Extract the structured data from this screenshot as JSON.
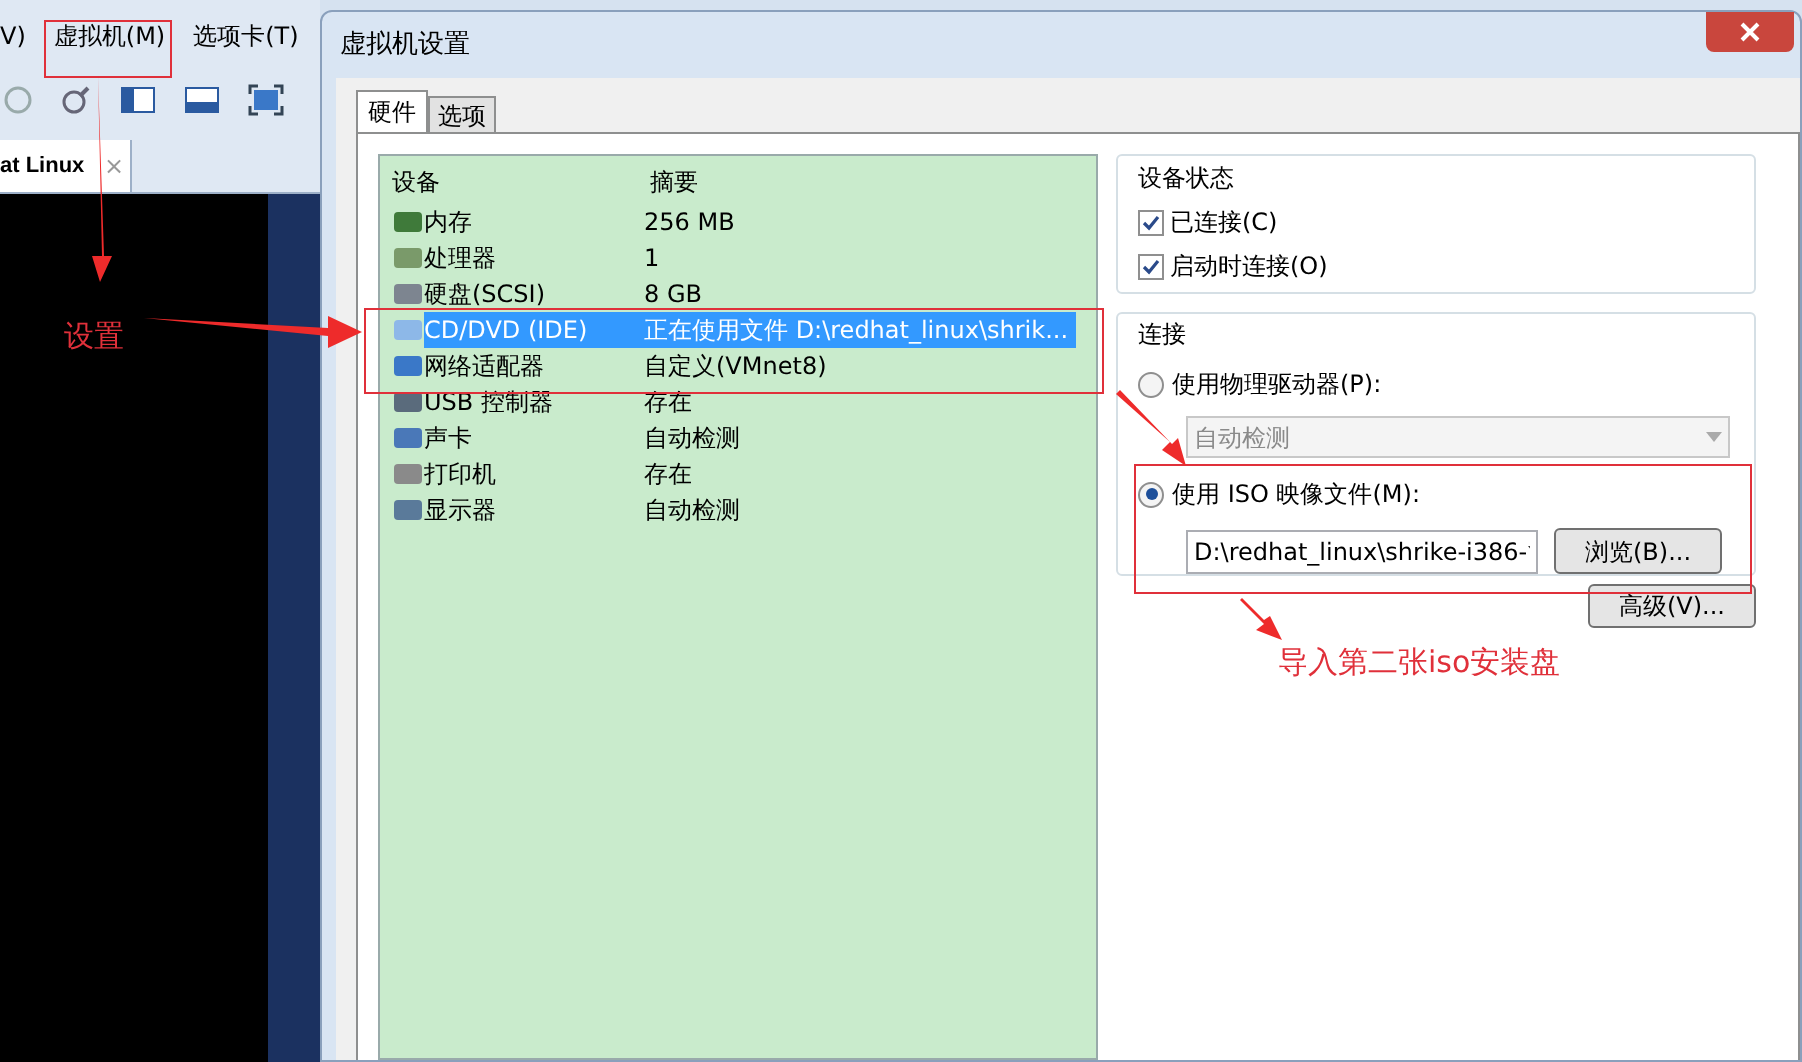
{
  "background_app": {
    "menu": [
      {
        "label": "V)"
      },
      {
        "label": "虚拟机(M)"
      },
      {
        "label": "选项卡(T)"
      }
    ],
    "tab": {
      "label": "at Linux",
      "close": "×"
    }
  },
  "dialog": {
    "title": "虚拟机设置",
    "tabs": [
      {
        "label": "硬件",
        "selected": true
      },
      {
        "label": "选项",
        "selected": false
      }
    ],
    "devices": {
      "columns": [
        "设备",
        "摘要"
      ],
      "rows": [
        {
          "device": "内存",
          "summary": "256 MB",
          "selected": false
        },
        {
          "device": "处理器",
          "summary": "1",
          "selected": false
        },
        {
          "device": "硬盘(SCSI)",
          "summary": "8 GB",
          "selected": false
        },
        {
          "device": "CD/DVD (IDE)",
          "summary": "正在使用文件 D:\\redhat_linux\\shrik...",
          "selected": true
        },
        {
          "device": "网络适配器",
          "summary": "自定义(VMnet8)",
          "selected": false
        },
        {
          "device": "USB 控制器",
          "summary": "存在",
          "selected": false
        },
        {
          "device": "声卡",
          "summary": "自动检测",
          "selected": false
        },
        {
          "device": "打印机",
          "summary": "存在",
          "selected": false
        },
        {
          "device": "显示器",
          "summary": "自动检测",
          "selected": false
        }
      ]
    },
    "device_status": {
      "title": "设备状态",
      "options": [
        {
          "label": "已连接(C)",
          "checked": true
        },
        {
          "label": "启动时连接(O)",
          "checked": true
        }
      ]
    },
    "connection": {
      "title": "连接",
      "options": [
        {
          "label": "使用物理驱动器(P):",
          "selected": false
        },
        {
          "label": "使用 ISO 映像文件(M):",
          "selected": true
        }
      ],
      "drive_select": {
        "value": "自动检测",
        "disabled": true
      },
      "iso_path": {
        "value": "D:\\redhat_linux\\shrike-i386-"
      },
      "browse_button": "浏览(B)..."
    },
    "advanced_button": "高级(V)..."
  },
  "annotations": [
    {
      "text": "设置"
    },
    {
      "text": "导入第二张iso安装盘"
    }
  ]
}
